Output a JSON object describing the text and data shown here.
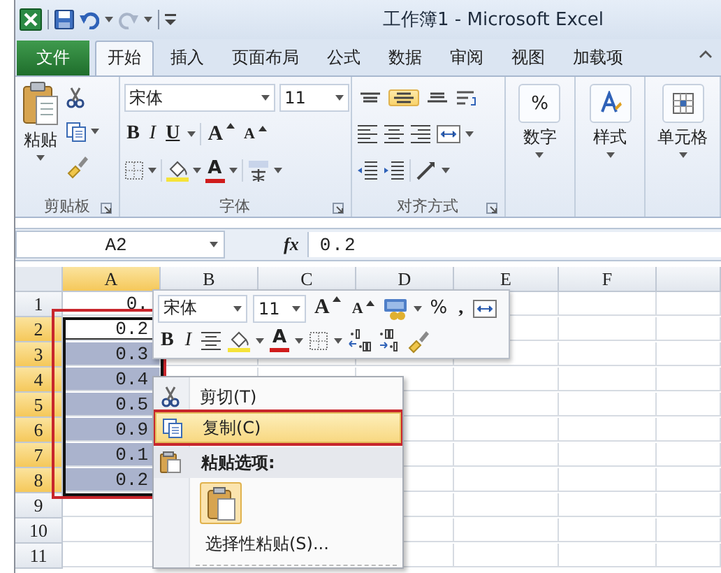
{
  "window": {
    "title": "工作簿1 - Microsoft Excel"
  },
  "ribbon_tabs": [
    {
      "label": "文件",
      "kind": "file",
      "selected": false
    },
    {
      "label": "开始",
      "kind": "tab",
      "selected": true
    },
    {
      "label": "插入",
      "kind": "tab",
      "selected": false
    },
    {
      "label": "页面布局",
      "kind": "tab",
      "selected": false
    },
    {
      "label": "公式",
      "kind": "tab",
      "selected": false
    },
    {
      "label": "数据",
      "kind": "tab",
      "selected": false
    },
    {
      "label": "审阅",
      "kind": "tab",
      "selected": false
    },
    {
      "label": "视图",
      "kind": "tab",
      "selected": false
    },
    {
      "label": "加载项",
      "kind": "tab",
      "selected": false
    }
  ],
  "ribbon": {
    "clipboard": {
      "paste": "粘贴",
      "label": "剪贴板"
    },
    "font": {
      "font_name": "宋体",
      "font_size": "11",
      "bold": "B",
      "italic": "I",
      "underline": "U",
      "grow": "A",
      "shrink": "A",
      "font_color": "A",
      "label": "字体"
    },
    "alignment": {
      "vertical_align": [
        {
          "selected": false
        },
        {
          "selected": true
        },
        {
          "selected": false
        }
      ],
      "label": "对齐方式"
    },
    "number": {
      "symbol": "%",
      "label": "数字"
    },
    "styles": {
      "label": "样式"
    },
    "cells": {
      "label": "单元格"
    }
  },
  "formula_bar": {
    "name_box": "A2",
    "function_label": "fx",
    "value": "0.2"
  },
  "sheet": {
    "columns": [
      {
        "label": "A",
        "selected": true
      },
      {
        "label": "B",
        "selected": false
      },
      {
        "label": "C",
        "selected": false
      },
      {
        "label": "D",
        "selected": false
      },
      {
        "label": "E",
        "selected": false
      },
      {
        "label": "F",
        "selected": false
      }
    ],
    "rows": [
      {
        "number": "1",
        "selected": false,
        "cells": [
          {
            "value": "0.",
            "selected": false,
            "active": false
          }
        ]
      },
      {
        "number": "2",
        "selected": true,
        "cells": [
          {
            "value": "0.2",
            "selected": false,
            "active": true
          }
        ]
      },
      {
        "number": "3",
        "selected": true,
        "cells": [
          {
            "value": "0.3",
            "selected": true,
            "active": false
          }
        ]
      },
      {
        "number": "4",
        "selected": true,
        "cells": [
          {
            "value": "0.4",
            "selected": true,
            "active": false
          }
        ]
      },
      {
        "number": "5",
        "selected": true,
        "cells": [
          {
            "value": "0.5",
            "selected": true,
            "active": false
          }
        ]
      },
      {
        "number": "6",
        "selected": true,
        "cells": [
          {
            "value": "0.9",
            "selected": true,
            "active": false
          }
        ]
      },
      {
        "number": "7",
        "selected": true,
        "cells": [
          {
            "value": "0.1",
            "selected": true,
            "active": false
          }
        ]
      },
      {
        "number": "8",
        "selected": true,
        "cells": [
          {
            "value": "0.2",
            "selected": true,
            "active": false
          }
        ]
      },
      {
        "number": "9",
        "selected": false
      },
      {
        "number": "10",
        "selected": false
      },
      {
        "number": "11",
        "selected": false
      }
    ],
    "selection_outlined": true
  },
  "mini_toolbar": {
    "font_name": "宋体",
    "font_size": "11",
    "grow": "A",
    "shrink": "A",
    "percent": "%",
    "comma": ",",
    "bold": "B",
    "italic": "I",
    "font_color": "A"
  },
  "context_menu": {
    "items": [
      {
        "kind": "cut",
        "label": "剪切(T)",
        "selected": false,
        "outlined": false
      },
      {
        "kind": "copy",
        "label": "复制(C)",
        "selected": true,
        "outlined": true
      },
      {
        "kind": "header",
        "label": "粘贴选项:"
      },
      {
        "kind": "paste_options"
      },
      {
        "kind": "paste_special",
        "label": "选择性粘贴(S)...",
        "selected": false,
        "outlined": false
      }
    ]
  }
}
